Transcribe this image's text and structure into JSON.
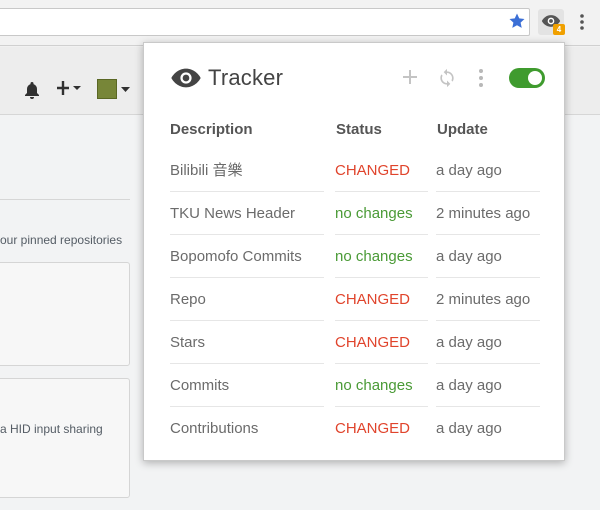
{
  "background": {
    "pinned_text": "our pinned repositories",
    "card_desc": "a HID input sharing"
  },
  "extension": {
    "badge": "4"
  },
  "popup": {
    "title": "Tracker",
    "toggle_on": true,
    "columns": {
      "description": "Description",
      "status": "Status",
      "update": "Update"
    },
    "rows": [
      {
        "description": "Bilibili 音樂",
        "status": "CHANGED",
        "update": "a day ago",
        "changed": true
      },
      {
        "description": "TKU News Header",
        "status": "no changes",
        "update": "2 minutes ago",
        "changed": false
      },
      {
        "description": "Bopomofo Commits",
        "status": "no changes",
        "update": "a day ago",
        "changed": false
      },
      {
        "description": "Repo",
        "status": "CHANGED",
        "update": "2 minutes ago",
        "changed": true
      },
      {
        "description": "Stars",
        "status": "CHANGED",
        "update": "a day ago",
        "changed": true
      },
      {
        "description": "Commits",
        "status": "no changes",
        "update": "a day ago",
        "changed": false
      },
      {
        "description": "Contributions",
        "status": "CHANGED",
        "update": "a day ago",
        "changed": true
      }
    ]
  },
  "colors": {
    "changed": "#e0442c",
    "no_changes": "#4a9a36",
    "toggle": "#3f9b2e",
    "badge": "#f0a000",
    "star": "#3b6fd6"
  },
  "icons": [
    "star-icon",
    "eye-icon",
    "menu-dots-icon",
    "bell-icon",
    "plus-icon",
    "add-icon",
    "refresh-icon",
    "more-vert-icon"
  ]
}
